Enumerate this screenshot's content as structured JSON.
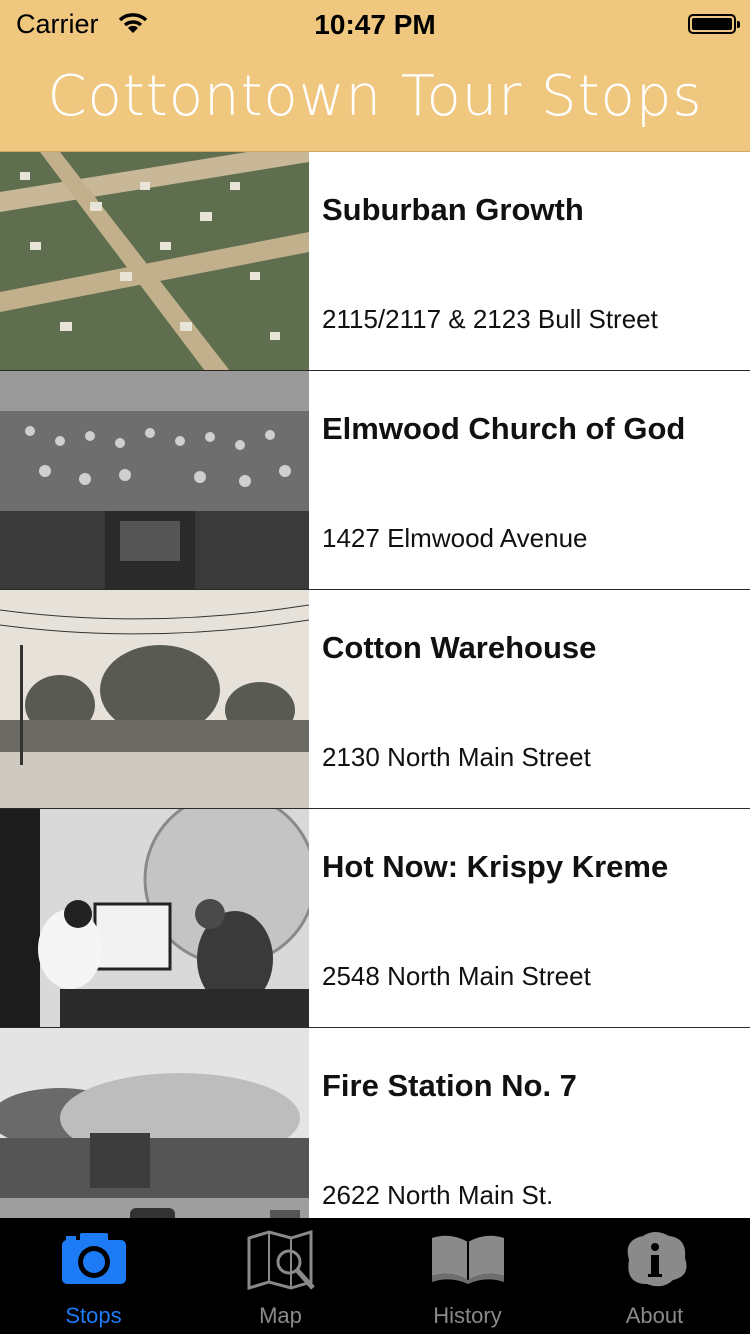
{
  "status_bar": {
    "carrier": "Carrier",
    "time": "10:47 PM"
  },
  "nav": {
    "title": "Cottontown Tour Stops"
  },
  "stops": [
    {
      "title": "Suburban Growth",
      "address": "2115/2117 & 2123 Bull Street"
    },
    {
      "title": "Elmwood Church of God",
      "address": "1427 Elmwood Avenue"
    },
    {
      "title": "Cotton Warehouse",
      "address": "2130 North Main Street"
    },
    {
      "title": "Hot Now: Krispy Kreme",
      "address": "2548 North Main Street"
    },
    {
      "title": "Fire Station No. 7",
      "address": "2622 North Main St."
    }
  ],
  "tabs": [
    {
      "label": "Stops",
      "icon": "camera-icon",
      "active": true
    },
    {
      "label": "Map",
      "icon": "map-icon",
      "active": false
    },
    {
      "label": "History",
      "icon": "book-icon",
      "active": false
    },
    {
      "label": "About",
      "icon": "info-icon",
      "active": false
    }
  ],
  "colors": {
    "header": "#efc77f",
    "active_tab": "#1e7bf6",
    "inactive_tab": "#8a8a8a"
  }
}
